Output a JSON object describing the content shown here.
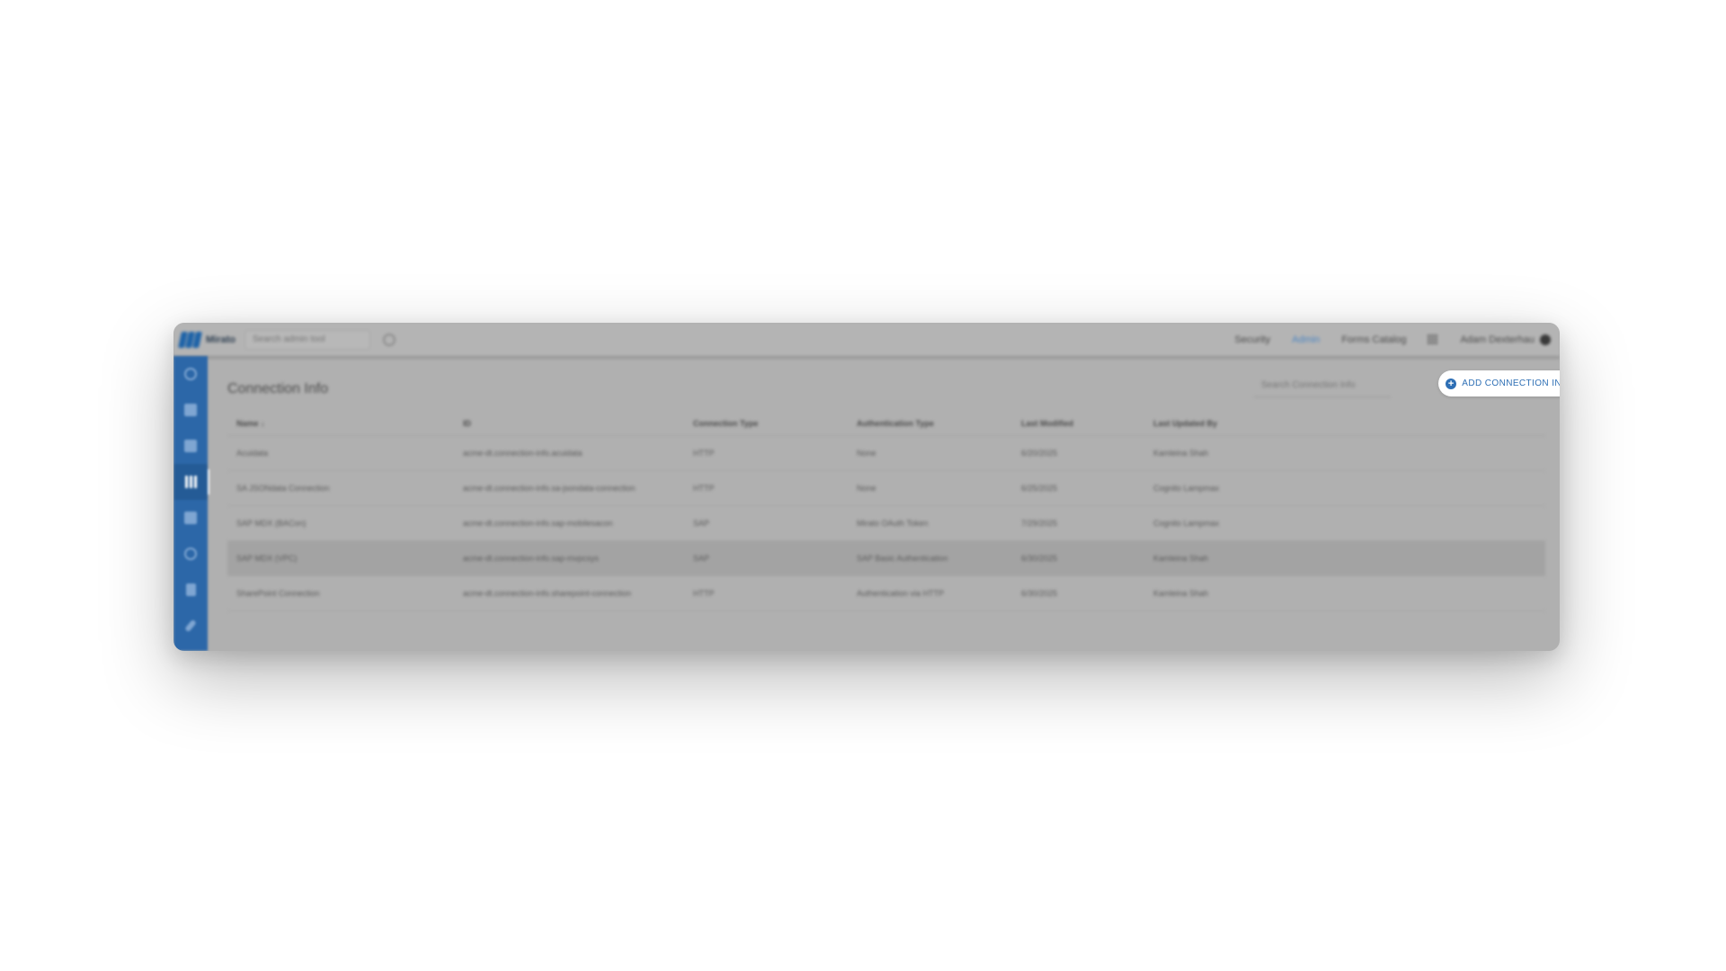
{
  "app": {
    "logo_text": "Mirato",
    "search_placeholder": "Search admin tool"
  },
  "topnav": {
    "items": [
      {
        "label": "Security",
        "active": false
      },
      {
        "label": "Admin",
        "active": true
      },
      {
        "label": "Forms Catalog",
        "active": false
      }
    ],
    "user_name": "Adam Dexterhau"
  },
  "sidebar": {
    "items": [
      {
        "icon": "cloud-icon",
        "active": false
      },
      {
        "icon": "dashboard-icon",
        "active": false
      },
      {
        "icon": "list-icon",
        "active": false
      },
      {
        "icon": "connections-icon",
        "active": true
      },
      {
        "icon": "grid-icon",
        "active": false
      },
      {
        "icon": "clock-icon",
        "active": false
      },
      {
        "icon": "document-icon",
        "active": false
      },
      {
        "icon": "attachment-icon",
        "active": false
      }
    ]
  },
  "page": {
    "title": "Connection Info",
    "search_placeholder": "Search Connection Info",
    "add_button_label": "ADD CONNECTION INFO"
  },
  "table": {
    "columns": [
      "Name ↓",
      "ID",
      "Connection Type",
      "Authentication Type",
      "Last Modified",
      "Last Updated By"
    ],
    "rows": [
      [
        "Acuidata",
        "acme-dt.connection-info.acuidata",
        "HTTP",
        "None",
        "6/20/2025",
        "Kamleina Shah"
      ],
      [
        "SA JSONdata Connection",
        "acme-dt.connection-info.sa-jsondata-connection",
        "HTTP",
        "None",
        "6/25/2025",
        "Cognito Lampmax"
      ],
      [
        "SAP MDX (BACon)",
        "acme-dt.connection-info.sap-mobilesacon",
        "SAP",
        "Mirato OAuth Token",
        "7/29/2025",
        "Cognito Lampmax"
      ],
      [
        "SAP MDX (VPC)",
        "acme-dt.connection-info.sap-mvpcsys",
        "SAP",
        "SAP Basic Authentication",
        "6/30/2025",
        "Kamleina Shah"
      ],
      [
        "SharePoint Connection",
        "acme-dt.connection-info.sharepoint-connection",
        "HTTP",
        "Authentication via HTTP",
        "6/30/2025",
        "Kamleina Shah"
      ]
    ],
    "highlighted_row": 3
  },
  "colors": {
    "accent": "#2e6fb5",
    "sidebar": "#2c67a8",
    "overlay": "#b0b0b0"
  }
}
